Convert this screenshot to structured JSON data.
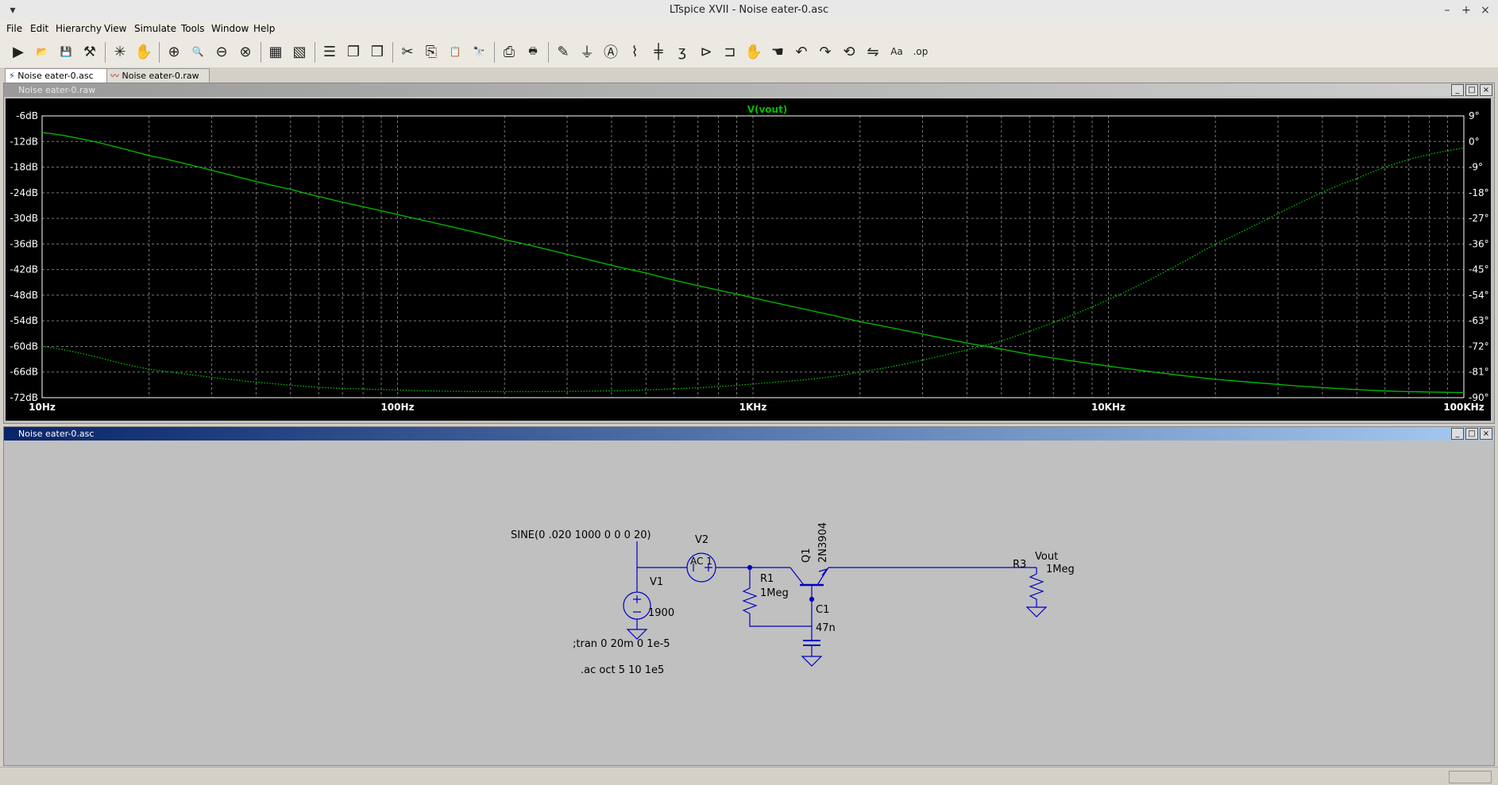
{
  "window": {
    "title": "LTspice XVII - Noise eater-0.asc",
    "menu_icon": "chevron-down-icon",
    "controls": [
      "–",
      "+",
      "×"
    ]
  },
  "menu": [
    "File",
    "Edit",
    "Hierarchy",
    "View",
    "Simulate",
    "Tools",
    "Window",
    "Help"
  ],
  "toolbar": [
    {
      "name": "run-button",
      "glyph": "▶"
    },
    {
      "name": "open-button",
      "glyph": "📂"
    },
    {
      "name": "save-button",
      "glyph": "💾"
    },
    {
      "name": "control-panel-button",
      "glyph": "⚒"
    },
    {
      "name": "halt-button",
      "glyph": "✳"
    },
    {
      "name": "pan-button",
      "glyph": "✋"
    },
    {
      "name": "zoom-in-button",
      "glyph": "⊕"
    },
    {
      "name": "zoom-area-button",
      "glyph": "🔍"
    },
    {
      "name": "zoom-out-button",
      "glyph": "⊖"
    },
    {
      "name": "zoom-fit-button",
      "glyph": "⊗"
    },
    {
      "name": "autorange-button",
      "glyph": "▦"
    },
    {
      "name": "grid-button",
      "glyph": "▧"
    },
    {
      "name": "tile-horizontal-button",
      "glyph": "☰"
    },
    {
      "name": "cascade-button",
      "glyph": "❐"
    },
    {
      "name": "tile-vertical-button",
      "glyph": "❒"
    },
    {
      "name": "cut-button",
      "glyph": "✂"
    },
    {
      "name": "copy-button",
      "glyph": "⎘"
    },
    {
      "name": "paste-button",
      "glyph": "📋"
    },
    {
      "name": "find-button",
      "glyph": "🔭"
    },
    {
      "name": "print-preview-button",
      "glyph": "⎙"
    },
    {
      "name": "print-button",
      "glyph": "🖶"
    },
    {
      "name": "draw-wire-button",
      "glyph": "✎"
    },
    {
      "name": "ground-button",
      "glyph": "⏚"
    },
    {
      "name": "label-net-button",
      "glyph": "Ⓐ"
    },
    {
      "name": "resistor-button",
      "glyph": "⌇"
    },
    {
      "name": "capacitor-button",
      "glyph": "╪"
    },
    {
      "name": "inductor-button",
      "glyph": "ʒ"
    },
    {
      "name": "diode-button",
      "glyph": "⊳"
    },
    {
      "name": "component-button",
      "glyph": "⊐"
    },
    {
      "name": "move-button",
      "glyph": "✋"
    },
    {
      "name": "drag-button",
      "glyph": "☚"
    },
    {
      "name": "undo-button",
      "glyph": "↶"
    },
    {
      "name": "redo-button",
      "glyph": "↷"
    },
    {
      "name": "rotate-button",
      "glyph": "⟲"
    },
    {
      "name": "mirror-button",
      "glyph": "⇋"
    },
    {
      "name": "text-button",
      "glyph": "Aa"
    },
    {
      "name": "spice-directive-button",
      "glyph": ".op"
    }
  ],
  "tabs": [
    {
      "label": "Noise eater-0.asc",
      "icon": "schematic-icon",
      "active": true
    },
    {
      "label": "Noise eater-0.raw",
      "icon": "waveform-icon",
      "active": false
    }
  ],
  "plot_window": {
    "title": "Noise eater-0.raw",
    "buttons": [
      "_",
      "□",
      "×"
    ]
  },
  "schematic_window": {
    "title": "Noise eater-0.asc",
    "buttons": [
      "_",
      "□",
      "×"
    ],
    "labels": {
      "sine": "SINE(0 .020 1000 0 0 0 20)",
      "v2": "V2",
      "ac": "AC 1",
      "v1": "V1",
      "v1_value": "1900",
      "r1": "R1",
      "r1_value": "1Meg",
      "q1": "Q1",
      "q1_model": "2N3904",
      "c1": "C1",
      "c1_value": "47n",
      "r3": "R3",
      "r3_value": "1Meg",
      "vout": "Vout",
      "tran": ";tran 0 20m 0 1e-5",
      "ac_directive": ".ac oct 5 10 1e5"
    }
  },
  "chart_data": {
    "type": "line",
    "title": "V(vout)",
    "x_scale": "log",
    "xlim": [
      10,
      100000
    ],
    "x_ticks": [
      "10Hz",
      "100Hz",
      "1KHz",
      "10KHz",
      "100KHz"
    ],
    "ylim_left": [
      -72,
      -6
    ],
    "y_ticks_left": [
      "-6dB",
      "-12dB",
      "-18dB",
      "-24dB",
      "-30dB",
      "-36dB",
      "-42dB",
      "-48dB",
      "-54dB",
      "-60dB",
      "-66dB",
      "-72dB"
    ],
    "ylim_right": [
      -90,
      9
    ],
    "y_ticks_right": [
      "9°",
      "0°",
      "-9°",
      "-18°",
      "-27°",
      "-36°",
      "-45°",
      "-54°",
      "-63°",
      "-72°",
      "-81°",
      "-90°"
    ],
    "grid": true,
    "background": "#000000",
    "trace_color": "#00c000",
    "series": [
      {
        "style": "solid",
        "axis": "left",
        "x": [
          10,
          20,
          50,
          100,
          200,
          500,
          1000,
          2000,
          5000,
          10000,
          20000,
          50000,
          100000
        ],
        "y": [
          -9.9,
          -15.3,
          -23.2,
          -29.1,
          -35.0,
          -42.8,
          -48.6,
          -54.2,
          -60.6,
          -64.6,
          -67.7,
          -70.1,
          -70.8
        ]
      },
      {
        "style": "dotted",
        "axis": "right",
        "x": [
          10,
          20,
          50,
          100,
          200,
          500,
          1000,
          2000,
          5000,
          10000,
          20000,
          50000,
          100000
        ],
        "y": [
          -72.0,
          -80.0,
          -85.6,
          -87.3,
          -87.9,
          -87.3,
          -85.2,
          -81.0,
          -70.1,
          -55.6,
          -36.0,
          -13.0,
          -2.3
        ]
      }
    ]
  }
}
